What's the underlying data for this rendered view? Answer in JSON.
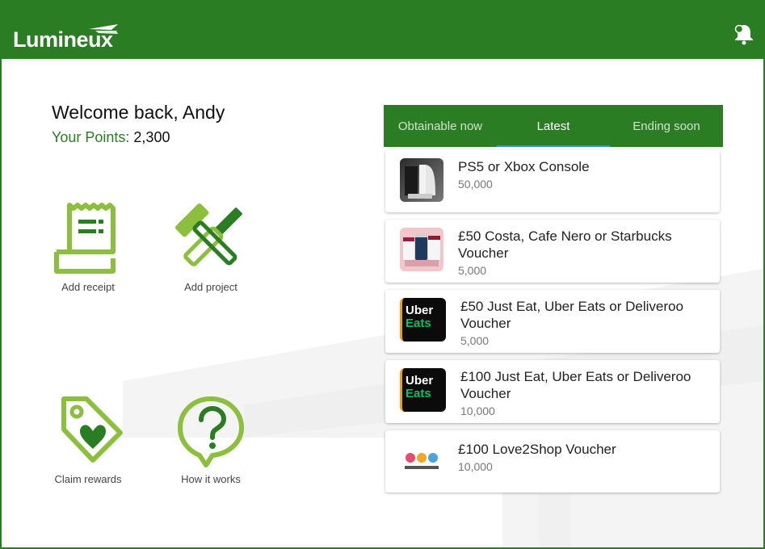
{
  "app": {
    "brand": "Lumineux",
    "accent": "#2a7d22"
  },
  "header": {
    "notification_icon": "bell-icon"
  },
  "welcome": {
    "greeting": "Welcome back, Andy",
    "points_label": "Your Points:",
    "points_value": "2,300"
  },
  "actions": [
    {
      "label": "Add receipt",
      "icon": "receipt-icon"
    },
    {
      "label": "Add project",
      "icon": "tools-icon"
    },
    {
      "label": "Claim rewards",
      "icon": "tag-heart-icon"
    },
    {
      "label": "How it works",
      "icon": "question-bubble-icon"
    }
  ],
  "tabs": [
    {
      "label": "Obtainable now",
      "active": false
    },
    {
      "label": "Latest",
      "active": true
    },
    {
      "label": "Ending soon",
      "active": false
    }
  ],
  "rewards": [
    {
      "title": "PS5 or Xbox Console",
      "points": "50,000",
      "thumb": "console-thumb"
    },
    {
      "title": "£50 Costa, Cafe Nero or Starbucks Voucher",
      "points": "5,000",
      "thumb": "coffee-thumb"
    },
    {
      "title": "£50 Just Eat, Uber Eats or Deliveroo Voucher",
      "points": "5,000",
      "thumb": "ubereats-thumb",
      "thumb_text": [
        "Uber",
        "Eats"
      ]
    },
    {
      "title": "£100 Just Eat, Uber Eats or Deliveroo Voucher",
      "points": "10,000",
      "thumb": "ubereats-thumb",
      "thumb_text": [
        "Uber",
        "Eats"
      ]
    },
    {
      "title": "£100 Love2Shop Voucher",
      "points": "10,000",
      "thumb": "love2shop-thumb"
    }
  ]
}
